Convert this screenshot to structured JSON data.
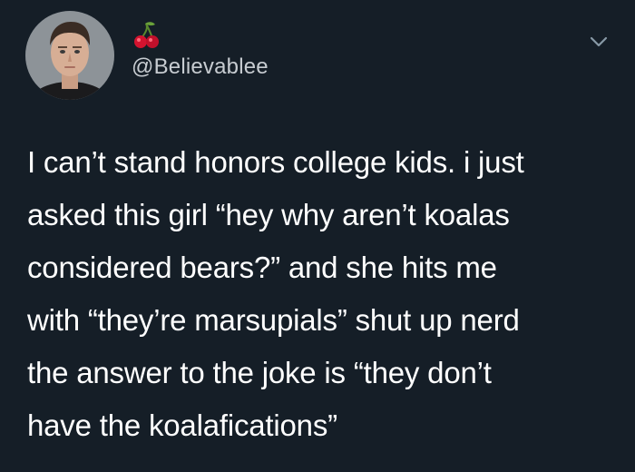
{
  "tweet": {
    "author_handle": "@Believablee",
    "name_emoji": "cherries",
    "lines": [
      "I can’t stand honors college kids. i just",
      "asked this girl “hey why aren’t koalas",
      "considered bears?” and she hits me",
      "with “they’re marsupials” shut up nerd",
      "the answer to the joke is “they don’t",
      "have the koalafications”"
    ]
  },
  "icons": {
    "avatar": "profile-photo",
    "menu": "chevron-down-icon",
    "emoji": "cherries-icon"
  },
  "colors": {
    "background": "#151e27",
    "text": "#ffffff",
    "handle": "#c7ccd1",
    "chevron": "#8899a6"
  }
}
